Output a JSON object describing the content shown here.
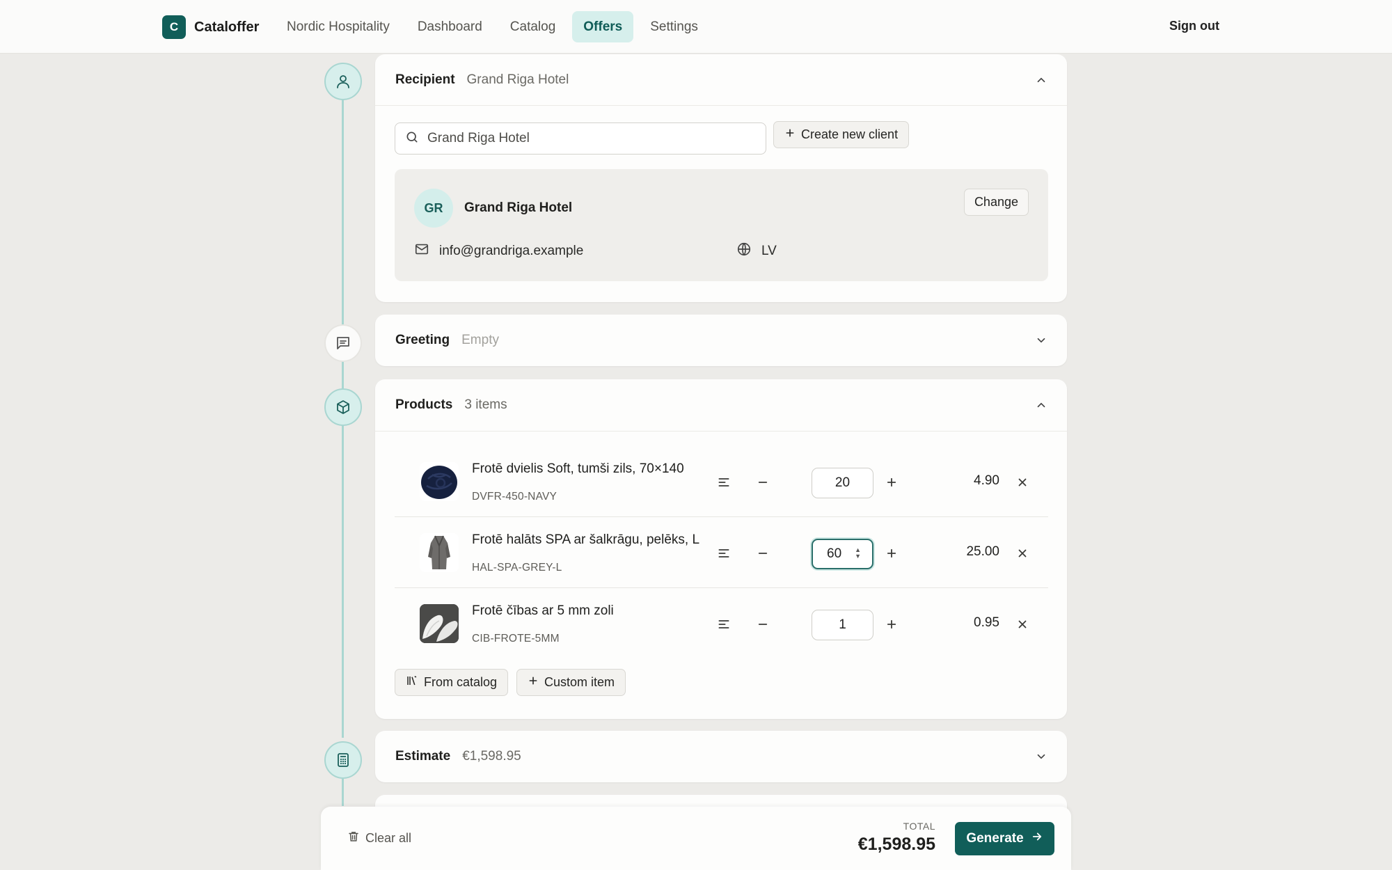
{
  "app": {
    "logo_letter": "C",
    "name": "Cataloffer"
  },
  "nav": {
    "org": "Nordic Hospitality",
    "items": [
      "Dashboard",
      "Catalog",
      "Offers",
      "Settings"
    ],
    "active": "Offers",
    "sign_out": "Sign out"
  },
  "colors": {
    "accent": "#115e59",
    "accent_light": "#d6efec",
    "rail": "#a9d6d1"
  },
  "recipient": {
    "title": "Recipient",
    "subtitle": "Grand Riga Hotel",
    "search_value": "Grand Riga Hotel",
    "create_label": "Create new client",
    "client": {
      "initials": "GR",
      "name": "Grand Riga Hotel",
      "change_label": "Change",
      "email": "info@grandriga.example",
      "country": "LV"
    }
  },
  "greeting": {
    "title": "Greeting",
    "subtitle": "Empty"
  },
  "products": {
    "title": "Products",
    "subtitle": "3 items",
    "items": [
      {
        "name": "Frotē dvielis Soft, tumši zils, 70×140",
        "sku": "DVFR-450-NAVY",
        "qty": "20",
        "price": "4.90",
        "thumb": "navy-towel"
      },
      {
        "name": "Frotē halāts SPA ar šalkrāgu, pelēks, L",
        "sku": "HAL-SPA-GREY-L",
        "qty": "60",
        "price": "25.00",
        "thumb": "grey-robe"
      },
      {
        "name": "Frotē čības ar 5 mm zoli",
        "sku": "CIB-FROTE-5MM",
        "qty": "1",
        "price": "0.95",
        "thumb": "white-slippers"
      }
    ],
    "from_catalog_label": "From catalog",
    "custom_item_label": "Custom item"
  },
  "estimate": {
    "title": "Estimate",
    "subtitle": "€1,598.95"
  },
  "footer": {
    "clear_label": "Clear all",
    "total_label": "TOTAL",
    "total_value": "€1,598.95",
    "generate_label": "Generate"
  }
}
